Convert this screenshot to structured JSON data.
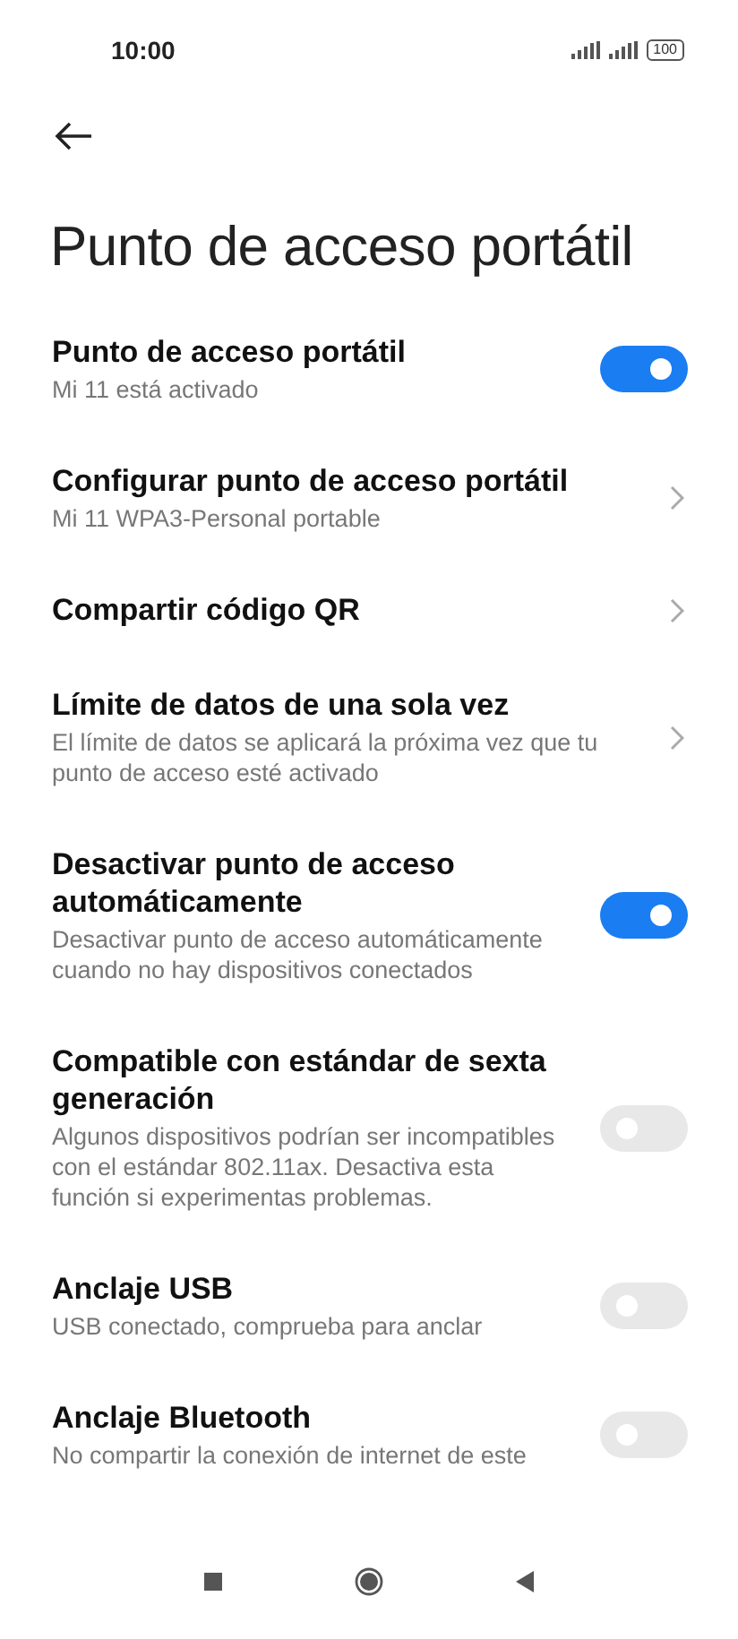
{
  "status_bar": {
    "time": "10:00",
    "battery": "100"
  },
  "title": "Punto de acceso portátil",
  "settings": [
    {
      "kind": "switch",
      "title": "Punto de acceso portátil",
      "subtitle": "Mi 11 está activado",
      "on": true
    },
    {
      "kind": "link",
      "title": "Configurar punto de acceso portátil",
      "subtitle": "Mi 11 WPA3-Personal portable"
    },
    {
      "kind": "link",
      "title": "Compartir código QR"
    },
    {
      "kind": "link",
      "title": "Límite de datos de una sola vez",
      "subtitle": "El límite de datos se aplicará la próxima vez que tu punto de acceso esté activado"
    },
    {
      "kind": "switch",
      "title": "Desactivar punto de acceso automáticamente",
      "subtitle": "Desactivar punto de acceso automáticamente cuando no hay dispositivos conectados",
      "on": true
    },
    {
      "kind": "switch",
      "title": "Compatible con estándar de sexta generación",
      "subtitle": "Algunos dispositivos podrían ser incompatibles con el estándar 802.11ax. Desactiva esta función si experimentas problemas.",
      "on": false
    },
    {
      "kind": "switch",
      "title": "Anclaje USB",
      "subtitle": "USB conectado, comprueba para anclar",
      "on": false
    },
    {
      "kind": "switch",
      "title": "Anclaje Bluetooth",
      "subtitle": "No compartir la conexión de internet de este",
      "on": false
    }
  ]
}
